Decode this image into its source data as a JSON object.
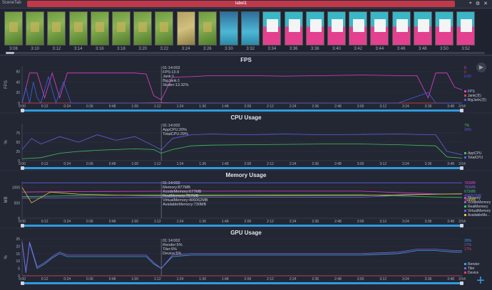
{
  "topbar": {
    "scene_tab": "SceneTab",
    "label": "label1",
    "icons": [
      "location-icon",
      "settings-icon",
      "close-icon"
    ]
  },
  "thumbnails": [
    {
      "time": "3:08",
      "kind": "game"
    },
    {
      "time": "3:10",
      "kind": "game"
    },
    {
      "time": "3:12",
      "kind": "game"
    },
    {
      "time": "3:14",
      "kind": "game"
    },
    {
      "time": "3:16",
      "kind": "game"
    },
    {
      "time": "3:18",
      "kind": "game"
    },
    {
      "time": "3:20",
      "kind": "game"
    },
    {
      "time": "3:22",
      "kind": "game"
    },
    {
      "time": "3:24",
      "kind": "sand"
    },
    {
      "time": "3:26",
      "kind": "game"
    },
    {
      "time": "3:30",
      "kind": "blue"
    },
    {
      "time": "3:32",
      "kind": "blue"
    },
    {
      "time": "3:34",
      "kind": "pink"
    },
    {
      "time": "3:36",
      "kind": "pink"
    },
    {
      "time": "3:38",
      "kind": "pink"
    },
    {
      "time": "3:40",
      "kind": "pink"
    },
    {
      "time": "3:42",
      "kind": "pink"
    },
    {
      "time": "3:44",
      "kind": "pink"
    },
    {
      "time": "3:46",
      "kind": "pink"
    },
    {
      "time": "3:48",
      "kind": "pink"
    },
    {
      "time": "3:50",
      "kind": "pink"
    },
    {
      "time": "3:52",
      "kind": "pink"
    }
  ],
  "x_ticks": [
    "0:00",
    "0:12",
    "0:24",
    "0:36",
    "0:48",
    "1:00",
    "1:12",
    "1:24",
    "1:36",
    "1:48",
    "2:00",
    "2:12",
    "2:24",
    "2:36",
    "2:48",
    "3:00",
    "3:12",
    "3:24",
    "3:36",
    "3:48",
    "3:54"
  ],
  "chart_data": [
    {
      "type": "line",
      "title": "FPS",
      "ylabel": "FPS",
      "ylim": [
        0,
        70
      ],
      "yticks": [
        "0",
        "20",
        "40",
        "60"
      ],
      "cursor": {
        "time": "01:14:002",
        "lines": [
          "FPS:13.9",
          "Jank:1",
          "BigJank:1",
          "Stutter:13.32%"
        ]
      },
      "series": [
        {
          "name": "FPS",
          "color": "#e040c8",
          "current": "0",
          "x": [
            0,
            4,
            8,
            12,
            16,
            20,
            24,
            30,
            40,
            50,
            60,
            66,
            70,
            74,
            80,
            90,
            100,
            120,
            140,
            160,
            180,
            200,
            210,
            216,
            220,
            226,
            230,
            234
          ],
          "y": [
            0,
            57,
            57,
            10,
            57,
            10,
            57,
            57,
            57,
            57,
            57,
            55,
            14,
            6,
            49,
            50,
            52,
            52,
            51,
            52,
            53,
            52,
            52,
            10,
            57,
            57,
            30,
            25
          ]
        },
        {
          "name": "Jank(次)",
          "color": "#e04040",
          "current": "0",
          "x": [
            0,
            10,
            20,
            40,
            60,
            74,
            90,
            120,
            160,
            200,
            234
          ],
          "y": [
            0,
            0,
            0,
            0,
            0,
            1,
            0,
            0,
            0,
            0,
            0
          ]
        },
        {
          "name": "BigJank(次)",
          "color": "#4060e0",
          "current": "0.00",
          "x": [
            0,
            2,
            4,
            6,
            8,
            10,
            14,
            18,
            22,
            26,
            40,
            80,
            120,
            160,
            200,
            216,
            220,
            234
          ],
          "y": [
            0,
            30,
            0,
            40,
            10,
            0,
            50,
            0,
            40,
            0,
            0,
            0,
            0,
            0,
            0,
            20,
            0,
            0
          ]
        }
      ],
      "legend": [
        "FPS",
        "Jank(次)",
        "BigJank(次)"
      ]
    },
    {
      "type": "line",
      "title": "CPU Usage",
      "ylabel": "%",
      "ylim": [
        0,
        100
      ],
      "yticks": [
        "0",
        "25",
        "50",
        "75"
      ],
      "cursor": {
        "time": "01:14:002",
        "lines": [
          "AppCPU:20%",
          "TotalCPU:29%"
        ]
      },
      "series": [
        {
          "name": "AppCPU",
          "color": "#40c060",
          "current": "7%",
          "x": [
            0,
            10,
            20,
            30,
            40,
            50,
            60,
            70,
            74,
            80,
            90,
            100,
            120,
            140,
            160,
            180,
            200,
            220,
            226,
            234
          ],
          "y": [
            5,
            8,
            20,
            25,
            28,
            30,
            32,
            30,
            20,
            30,
            40,
            42,
            43,
            44,
            45,
            45,
            43,
            40,
            10,
            7
          ]
        },
        {
          "name": "TotalCPU",
          "color": "#6060e0",
          "current": "16%",
          "x": [
            0,
            5,
            10,
            20,
            30,
            40,
            50,
            60,
            70,
            74,
            80,
            90,
            100,
            120,
            140,
            160,
            180,
            200,
            220,
            226,
            234
          ],
          "y": [
            30,
            60,
            45,
            65,
            50,
            70,
            55,
            65,
            40,
            29,
            60,
            70,
            72,
            70,
            72,
            70,
            71,
            72,
            70,
            25,
            16
          ]
        }
      ],
      "legend": [
        "AppCPU",
        "TotalCPU"
      ]
    },
    {
      "type": "line",
      "title": "Memory Usage",
      "ylabel": "MB",
      "ylim": [
        0,
        1200
      ],
      "yticks": [
        "0",
        "500",
        "1000"
      ],
      "cursor": {
        "time": "01:14:002",
        "lines": [
          "Memory:877MB",
          "XcodeMemory:677MB",
          "RealMemory:757MB",
          "VirtualMemory:406062MB",
          "AvailableMemory:730MB"
        ]
      },
      "series": [
        {
          "name": "Memory",
          "color": "#e040c8",
          "current": "783MB",
          "x": [
            0,
            20,
            40,
            74,
            120,
            180,
            220,
            234
          ],
          "y": [
            850,
            860,
            870,
            877,
            880,
            880,
            790,
            783
          ]
        },
        {
          "name": "XcodeMemory",
          "color": "#8060e0",
          "current": "783MB",
          "x": [
            0,
            20,
            40,
            74,
            120,
            180,
            220,
            234
          ],
          "y": [
            650,
            660,
            670,
            677,
            680,
            680,
            790,
            783
          ]
        },
        {
          "name": "RealMemory",
          "color": "#40c060",
          "current": "673MB",
          "x": [
            0,
            20,
            40,
            74,
            120,
            180,
            220,
            234
          ],
          "y": [
            700,
            720,
            740,
            757,
            760,
            760,
            690,
            673
          ]
        },
        {
          "name": "VirtualMemory",
          "color": "#6060e0",
          "current": "406057MB",
          "x": [
            0,
            234
          ],
          "y": [
            1150,
            1150
          ]
        },
        {
          "name": "AvailableMemory",
          "color": "#e0c040",
          "current": "794MB",
          "x": [
            0,
            5,
            15,
            30,
            50,
            74,
            120,
            180,
            220,
            234
          ],
          "y": [
            1000,
            500,
            850,
            780,
            750,
            730,
            735,
            740,
            780,
            794
          ]
        }
      ],
      "legend": [
        "Memory",
        "XcodeMemory",
        "RealMemory",
        "VirtualMemory",
        "AvailableMe..."
      ]
    },
    {
      "type": "line",
      "title": "GPU Usage",
      "ylabel": "%",
      "ylim": [
        0,
        25
      ],
      "yticks": [
        "0",
        "5",
        "10",
        "15",
        "20",
        "25"
      ],
      "cursor": {
        "time": "01:14:002",
        "lines": [
          "Render:5%",
          "Tiler:5%",
          "Device:5%"
        ]
      },
      "series": [
        {
          "name": "Render",
          "color": "#40a0e0",
          "current": "16%",
          "x": [
            0,
            2,
            4,
            8,
            12,
            16,
            20,
            24,
            30,
            40,
            60,
            66,
            70,
            74,
            80,
            90,
            100,
            120,
            140,
            160,
            180,
            200,
            210,
            220,
            230,
            234
          ],
          "y": [
            22,
            2,
            22,
            5,
            8,
            12,
            15,
            13,
            13,
            13,
            13,
            13,
            8,
            5,
            13,
            14,
            14,
            14,
            14,
            14,
            14,
            15,
            17,
            17,
            16,
            16
          ]
        },
        {
          "name": "Tiler",
          "color": "#8060e0",
          "current": "17%",
          "x": [
            0,
            2,
            4,
            8,
            12,
            16,
            20,
            24,
            30,
            40,
            60,
            66,
            70,
            74,
            80,
            90,
            100,
            120,
            140,
            160,
            180,
            200,
            210,
            220,
            230,
            234
          ],
          "y": [
            23,
            3,
            23,
            6,
            9,
            13,
            16,
            14,
            14,
            14,
            14,
            14,
            9,
            5,
            14,
            15,
            15,
            15,
            15,
            15,
            15,
            16,
            18,
            18,
            17,
            17
          ]
        },
        {
          "name": "Device",
          "color": "#e04060",
          "current": "17%",
          "x": [
            0,
            234
          ],
          "y": [
            0,
            0
          ]
        }
      ],
      "legend": [
        "Render",
        "Tiler",
        "Device"
      ]
    }
  ]
}
